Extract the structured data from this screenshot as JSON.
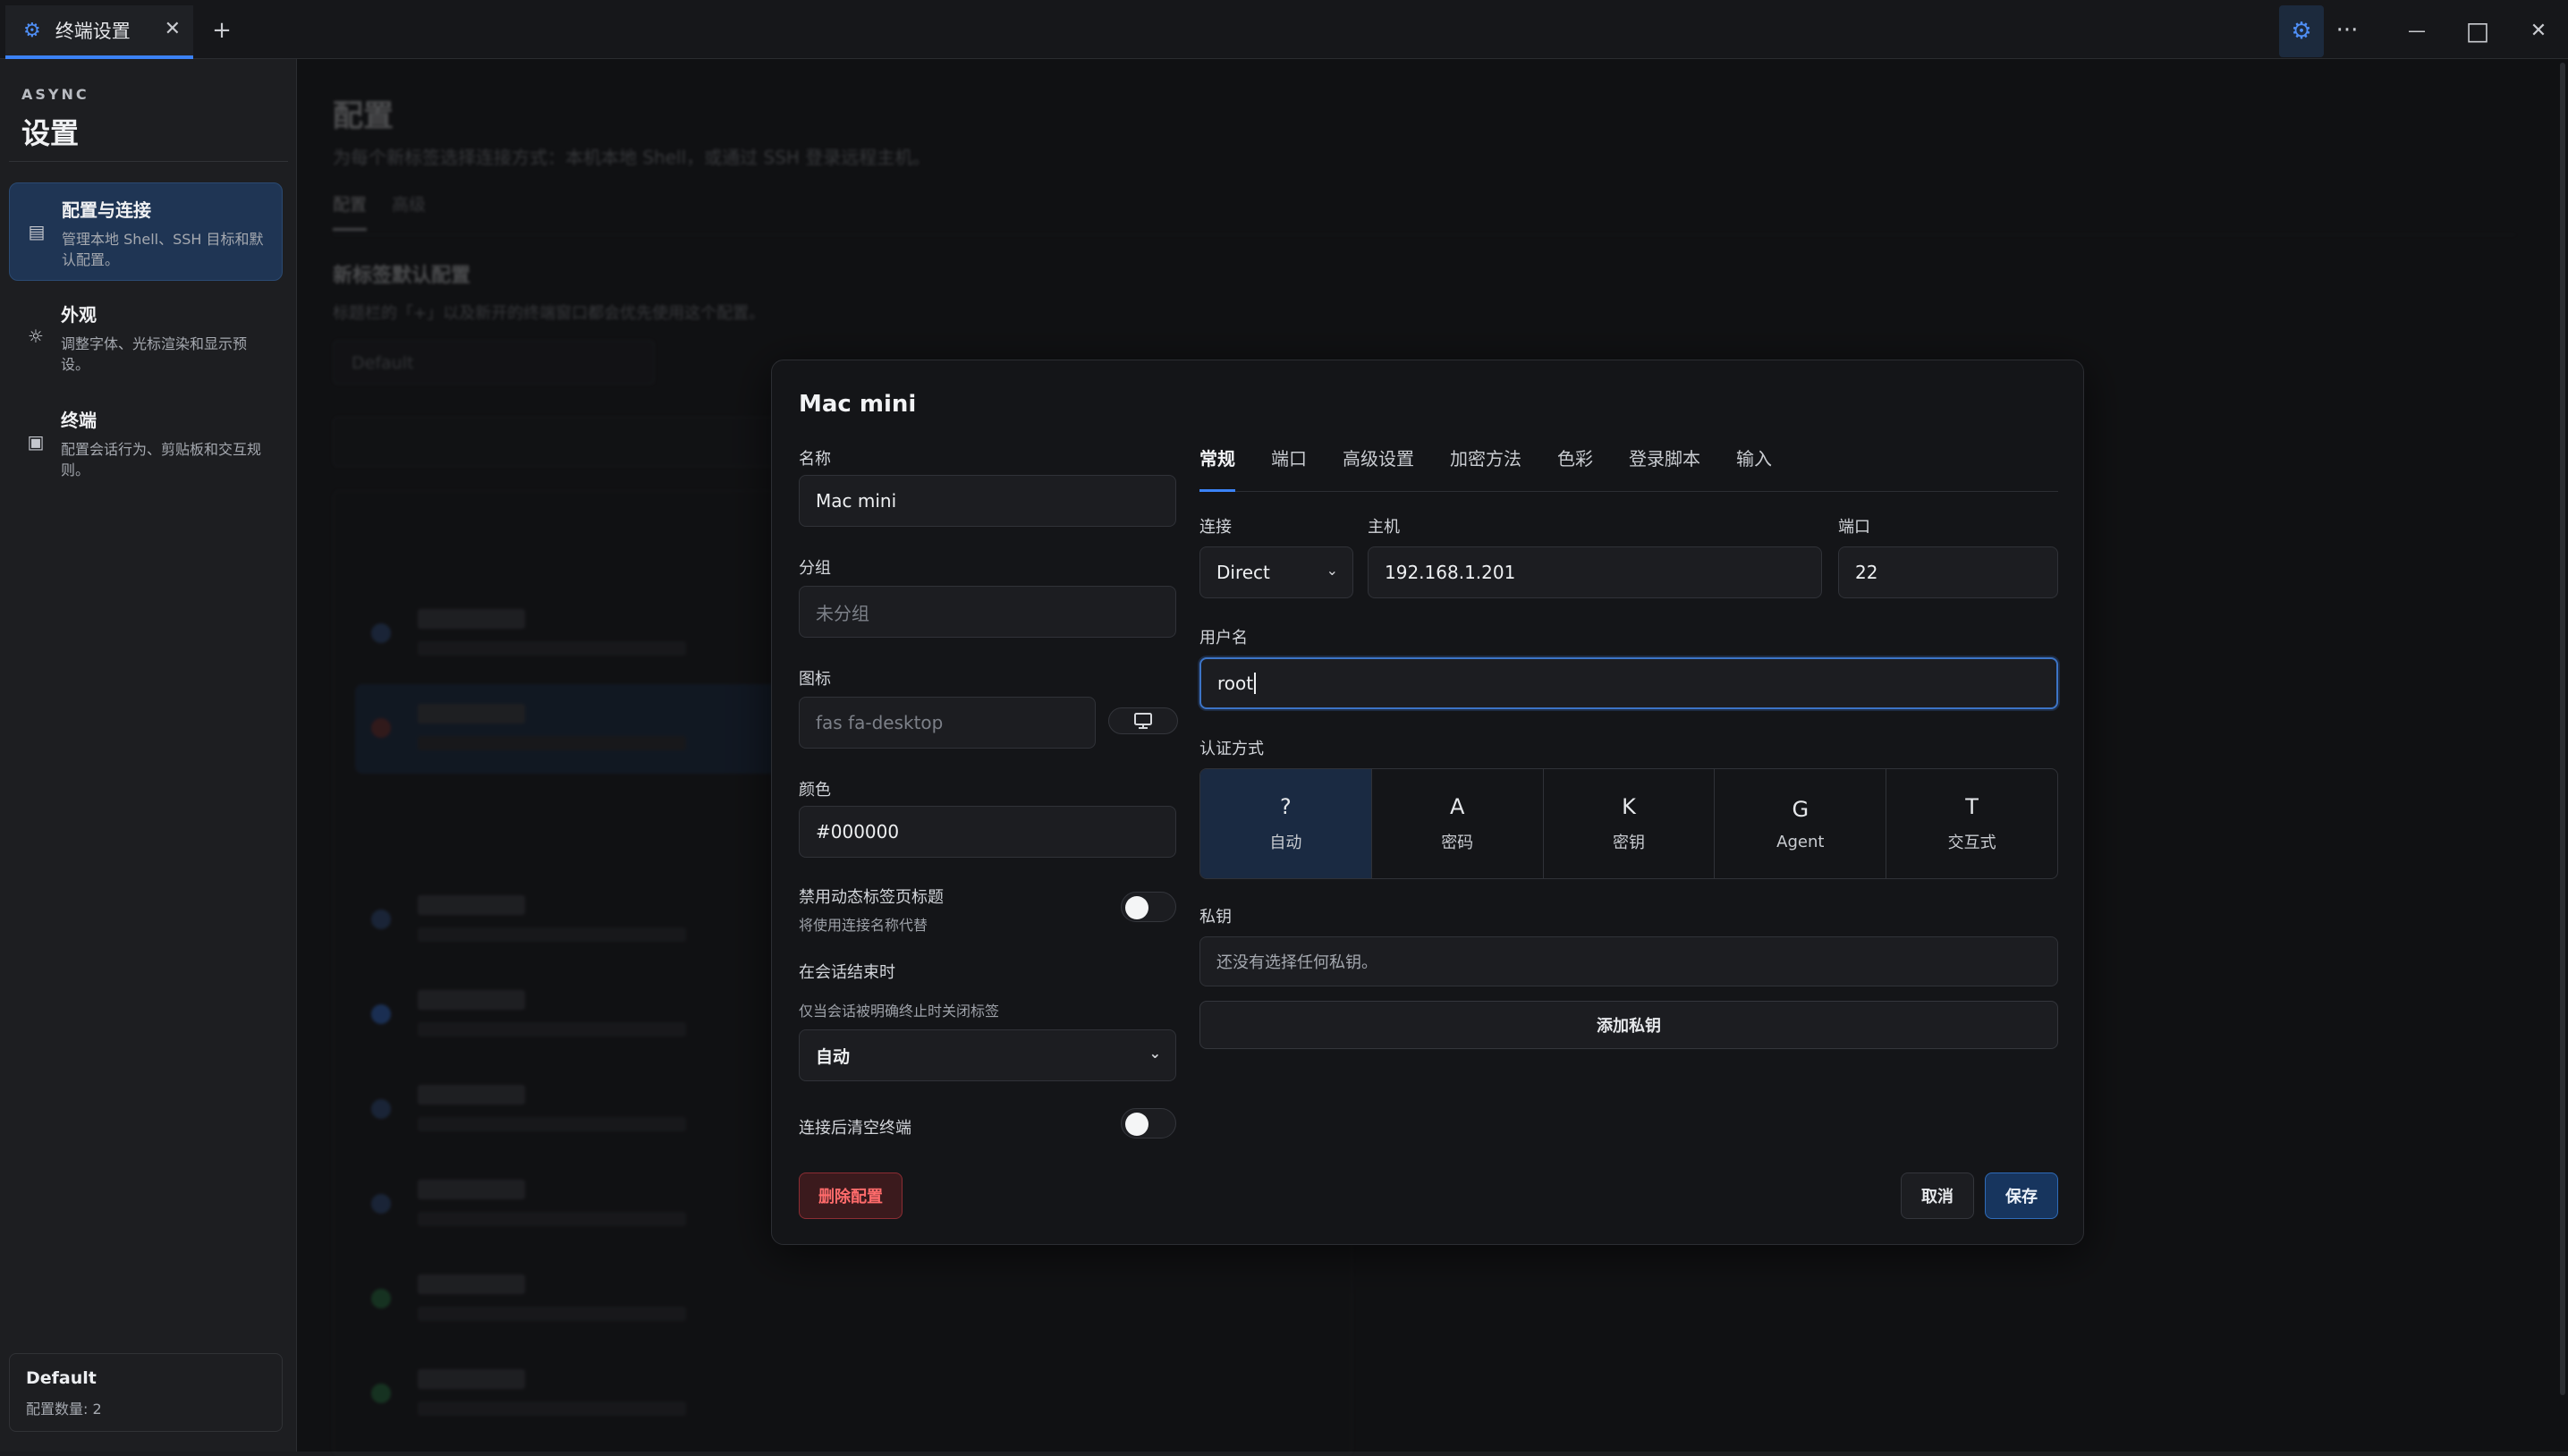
{
  "window": {
    "tab_title": "终端设置",
    "new_tab": "+",
    "controls": {
      "more": "···",
      "minimize": "—",
      "maximize": "□",
      "close": "✕"
    }
  },
  "sidebar": {
    "brand": "ASYNC",
    "title": "设置",
    "items": [
      {
        "title": "配置与连接",
        "desc": "管理本地 Shell、SSH 目标和默认配置。",
        "icon": "profile-card-icon"
      },
      {
        "title": "外观",
        "desc": "调整字体、光标渲染和显示预设。",
        "icon": "sun-icon"
      },
      {
        "title": "终端",
        "desc": "配置会话行为、剪贴板和交互规则。",
        "icon": "terminal-icon"
      }
    ],
    "footer": {
      "name": "Default",
      "count": "配置数量: 2"
    }
  },
  "background": {
    "title": "配置",
    "subtitle": "为每个新标签选择连接方式：本机本地 Shell，或通过 SSH 登录远程主机。",
    "tabs": [
      "配置",
      "高级"
    ],
    "section_title": "新标签默认配置",
    "section_desc": "标题栏的「+」以及新开的终端窗口都会优先使用这个配置。",
    "default_select": "Default"
  },
  "dialog": {
    "title": "Mac mini",
    "name_label": "名称",
    "name_value": "Mac mini",
    "group_label": "分组",
    "group_placeholder": "未分组",
    "icon_label": "图标",
    "icon_placeholder": "fas fa-desktop",
    "color_label": "颜色",
    "color_value": "#000000",
    "dynamic_title_label": "禁用动态标签页标题",
    "dynamic_title_hint": "将使用连接名称代替",
    "on_end_label": "在会话结束时",
    "on_end_hint": "仅当会话被明确终止时关闭标签",
    "on_end_value": "自动",
    "clear_label": "连接后清空终端",
    "tabs": [
      "常规",
      "端口",
      "高级设置",
      "加密方法",
      "色彩",
      "登录脚本",
      "输入"
    ],
    "connection_label": "连接",
    "connection_value": "Direct",
    "host_label": "主机",
    "host_value": "192.168.1.201",
    "port_label": "端口",
    "port_value": "22",
    "username_label": "用户名",
    "username_value": "root",
    "auth_label": "认证方式",
    "auth_options": [
      {
        "glyph": "?",
        "label": "自动"
      },
      {
        "glyph": "A",
        "label": "密码"
      },
      {
        "glyph": "K",
        "label": "密钥"
      },
      {
        "glyph": "G",
        "label": "Agent"
      },
      {
        "glyph": "T",
        "label": "交互式"
      }
    ],
    "private_key_label": "私钥",
    "private_key_empty": "还没有选择任何私钥。",
    "add_key": "添加私钥",
    "delete": "删除配置",
    "cancel": "取消",
    "save": "保存"
  }
}
